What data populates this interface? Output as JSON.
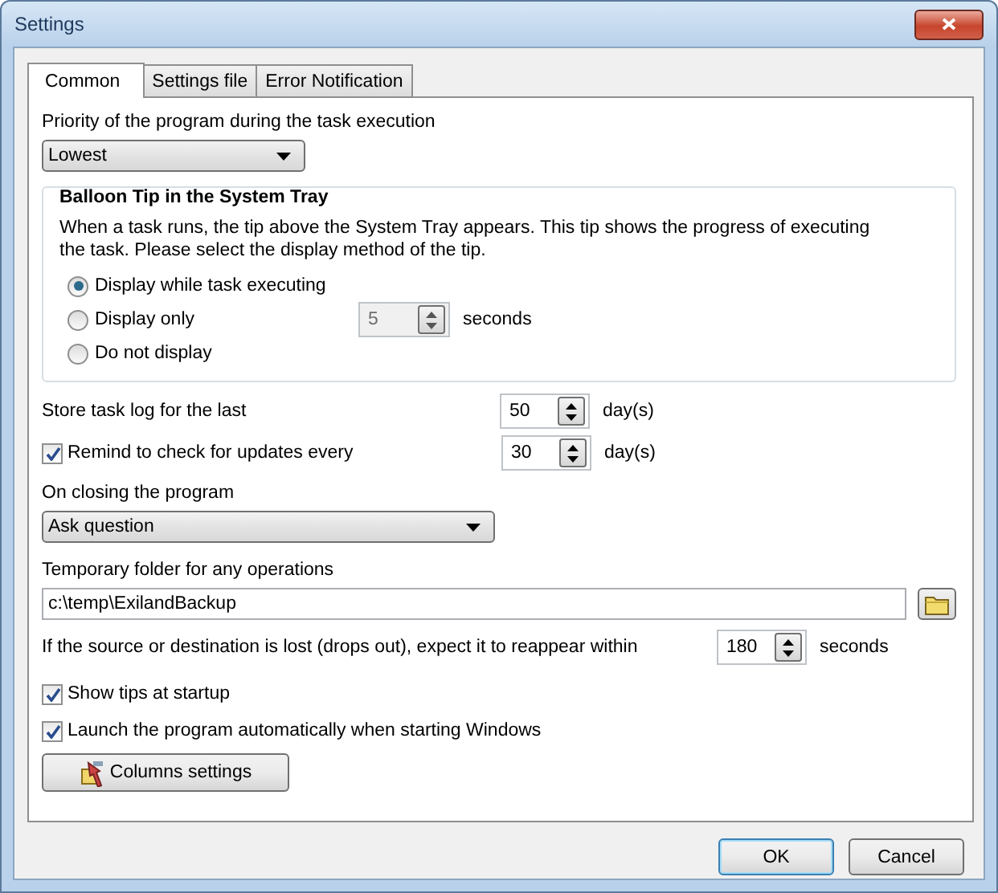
{
  "window": {
    "title": "Settings"
  },
  "tabs": [
    {
      "label": "Common",
      "selected": true
    },
    {
      "label": "Settings file",
      "selected": false
    },
    {
      "label": "Error Notification",
      "selected": false
    }
  ],
  "priority": {
    "label": "Priority of the program during the task execution",
    "value": "Lowest"
  },
  "balloon": {
    "title": "Balloon Tip in the System Tray",
    "description": "When a task runs, the tip above the System Tray appears. This tip shows the progress of executing the task. Please select the display method of the tip.",
    "options": [
      {
        "label": "Display while task executing",
        "selected": true
      },
      {
        "label": "Display only",
        "selected": false
      },
      {
        "label": "Do not display",
        "selected": false
      }
    ],
    "duration": {
      "value": "5",
      "unit": "seconds",
      "disabled": true
    }
  },
  "log": {
    "label": "Store task log for the last",
    "value": "50",
    "unit": "day(s)"
  },
  "updates": {
    "label": "Remind to check for updates every",
    "checked": true,
    "value": "30",
    "unit": "day(s)"
  },
  "closing": {
    "label": "On closing the program",
    "value": "Ask question"
  },
  "temp_folder": {
    "label": "Temporary folder for any operations",
    "value": "c:\\temp\\ExilandBackup"
  },
  "reappear": {
    "label": "If the source or destination is lost (drops out), expect it to reappear within",
    "value": "180",
    "unit": "seconds"
  },
  "options": [
    {
      "label": "Show tips at startup",
      "checked": true
    },
    {
      "label": "Launch the program automatically when starting Windows",
      "checked": true
    }
  ],
  "columns_button": "Columns settings",
  "buttons": [
    {
      "label": "OK",
      "default": true
    },
    {
      "label": "Cancel",
      "default": false
    }
  ]
}
